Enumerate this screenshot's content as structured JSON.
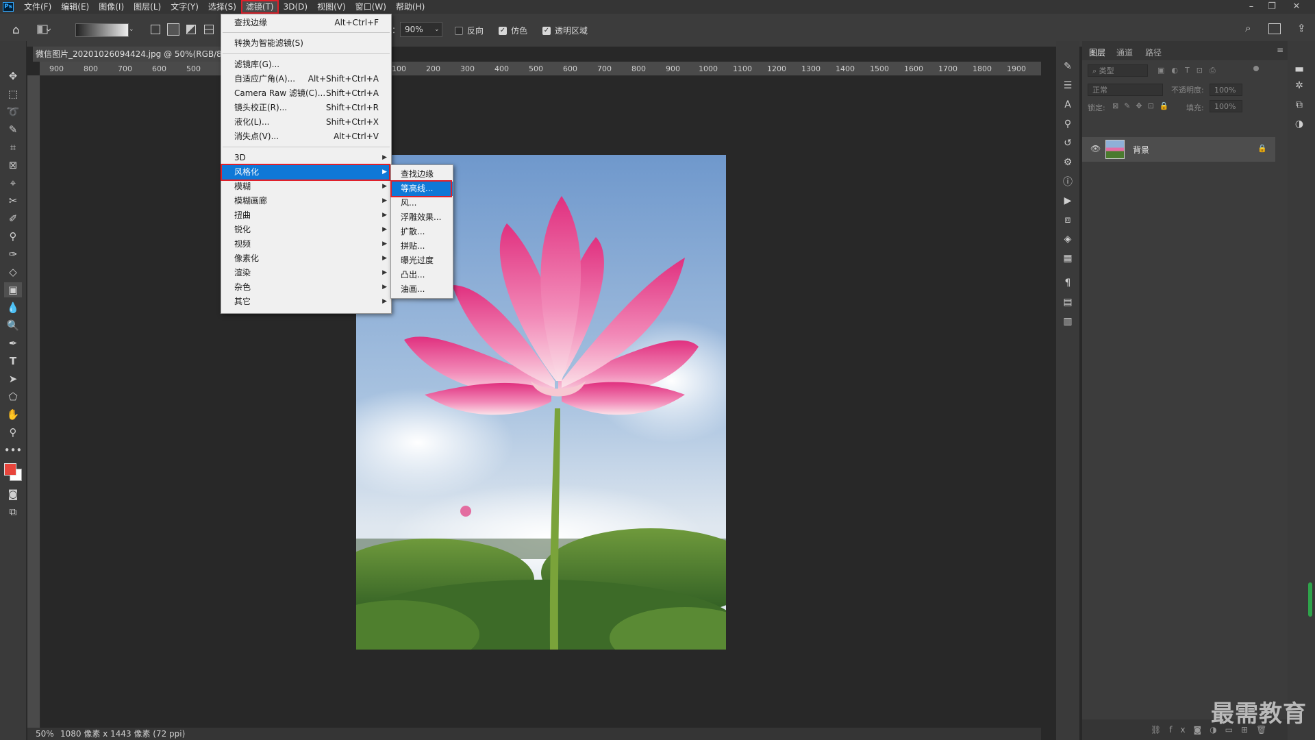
{
  "menubar": {
    "items": [
      "文件(F)",
      "编辑(E)",
      "图像(I)",
      "图层(L)",
      "文字(Y)",
      "选择(S)",
      "滤镜(T)",
      "3D(D)",
      "视图(V)",
      "窗口(W)",
      "帮助(H)"
    ],
    "logo": "Ps"
  },
  "options": {
    "opacity_label": "：",
    "opacity_value": "90%",
    "reverse_label": "反向",
    "dither_label": "仿色",
    "transparency_label": "透明区域",
    "reverse_checked": false,
    "dither_checked": true,
    "transparency_checked": true
  },
  "document": {
    "tab_title": "微信图片_20201026094424.jpg @ 50%(RGB/8#)",
    "zoom": "50%",
    "status": "1080 像素 x 1443 像素 (72 ppi)"
  },
  "ruler_top": [
    "900",
    "800",
    "700",
    "600",
    "500",
    "100",
    "200",
    "300",
    "400",
    "500",
    "600",
    "700",
    "800",
    "900",
    "1000",
    "1100",
    "1200",
    "1300",
    "1400",
    "1500",
    "1600",
    "1700",
    "1800",
    "1900"
  ],
  "filter_menu": {
    "items": [
      {
        "label": "查找边缘",
        "shortcut": "Alt+Ctrl+F"
      },
      {
        "label": "转换为智能滤镜(S)",
        "shortcut": ""
      },
      {
        "label": "滤镜库(G)...",
        "shortcut": ""
      },
      {
        "label": "自适应广角(A)...",
        "shortcut": "Alt+Shift+Ctrl+A"
      },
      {
        "label": "Camera Raw 滤镜(C)...",
        "shortcut": "Shift+Ctrl+A"
      },
      {
        "label": "镜头校正(R)...",
        "shortcut": "Shift+Ctrl+R"
      },
      {
        "label": "液化(L)...",
        "shortcut": "Shift+Ctrl+X"
      },
      {
        "label": "消失点(V)...",
        "shortcut": "Alt+Ctrl+V"
      },
      {
        "label": "3D",
        "shortcut": ""
      },
      {
        "label": "风格化",
        "shortcut": ""
      },
      {
        "label": "模糊",
        "shortcut": ""
      },
      {
        "label": "模糊画廊",
        "shortcut": ""
      },
      {
        "label": "扭曲",
        "shortcut": ""
      },
      {
        "label": "锐化",
        "shortcut": ""
      },
      {
        "label": "视频",
        "shortcut": ""
      },
      {
        "label": "像素化",
        "shortcut": ""
      },
      {
        "label": "渲染",
        "shortcut": ""
      },
      {
        "label": "杂色",
        "shortcut": ""
      },
      {
        "label": "其它",
        "shortcut": ""
      }
    ]
  },
  "stylize_submenu": {
    "items": [
      "查找边缘",
      "等高线...",
      "风...",
      "浮雕效果...",
      "扩散...",
      "拼贴...",
      "曝光过度",
      "凸出...",
      "油画..."
    ]
  },
  "layers_panel": {
    "tabs": [
      "图层",
      "通道",
      "路径"
    ],
    "filter_placeholder": "类型",
    "blend_mode": "正常",
    "opacity_label": "不透明度:",
    "opacity_value": "100%",
    "lock_label": "锁定:",
    "fill_label": "填充:",
    "fill_value": "100%",
    "layer_name": "背景"
  },
  "watermark": "最需教育",
  "colors": {
    "accent_highlight": "#0f78d7",
    "annotation_red": "#e0202a",
    "foreground_color": "#e8453c",
    "background_color": "#ffffff"
  }
}
